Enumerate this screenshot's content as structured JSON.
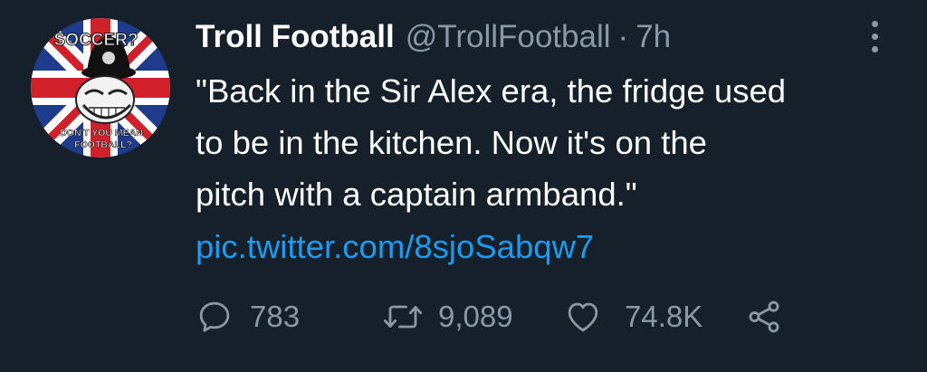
{
  "tweet": {
    "display_name": "Troll Football",
    "handle": "@TrollFootball",
    "separator": "·",
    "time": "7h",
    "text_lines": [
      "\"Back in the Sir Alex era, the fridge used",
      "to be in the kitchen. Now it's on the",
      "pitch with a captain armband.\""
    ],
    "link": "pic.twitter.com/8sjoSabqw7",
    "avatar": {
      "top_text": "SOCCER?",
      "bottom_text_1": "DON'T YOU MEAN",
      "bottom_text_2": "FOOTBALL?"
    },
    "actions": {
      "reply": {
        "icon": "reply-icon",
        "count": "783"
      },
      "retweet": {
        "icon": "retweet-icon",
        "count": "9,089"
      },
      "like": {
        "icon": "heart-icon",
        "count": "74.8K"
      },
      "share": {
        "icon": "share-icon"
      }
    }
  },
  "colors": {
    "background": "#15202b",
    "text": "#ffffff",
    "muted": "#8b98a5",
    "link": "#1d9bf0"
  }
}
